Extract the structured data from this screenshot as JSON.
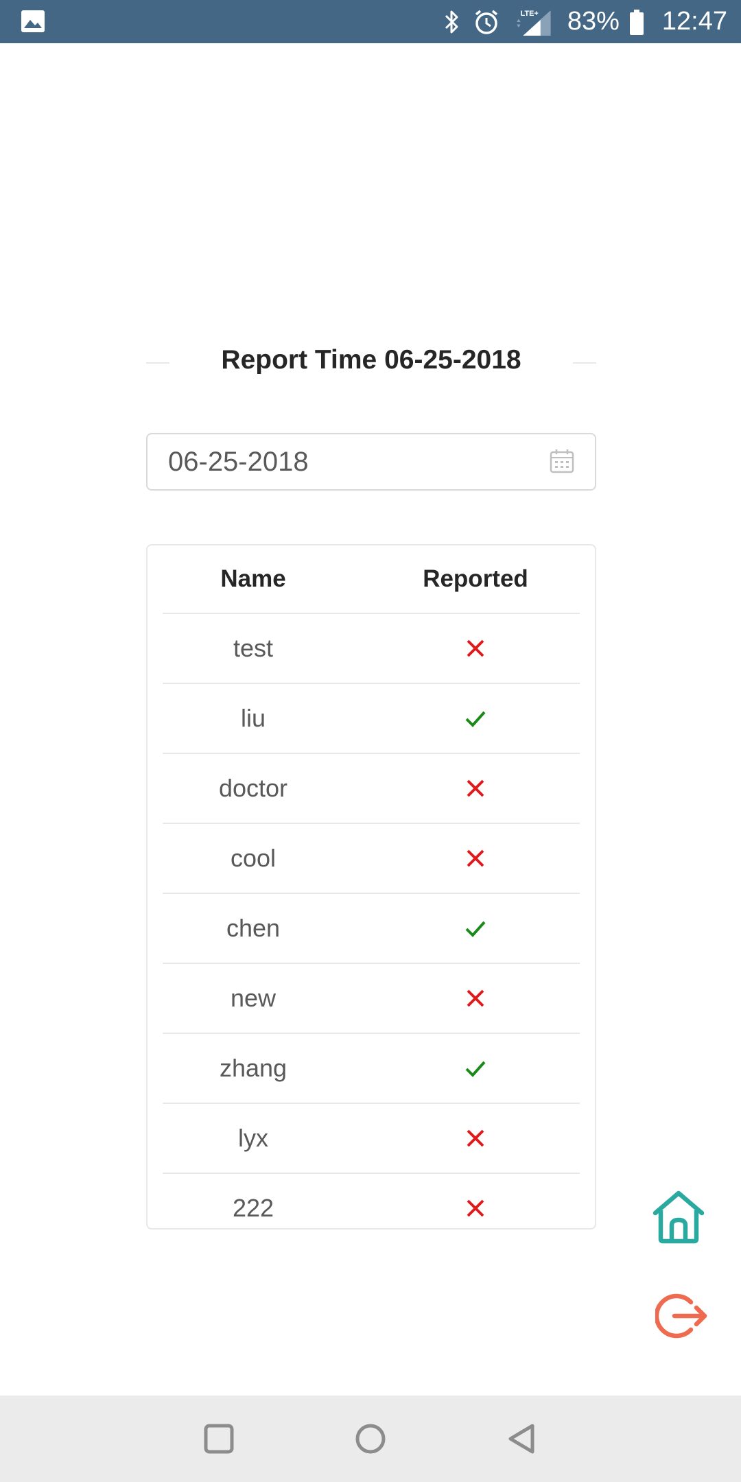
{
  "status_bar": {
    "battery": "83%",
    "time": "12:47",
    "network": "LTE+",
    "icons": [
      "gallery-icon",
      "bluetooth-icon",
      "alarm-icon",
      "signal-icon",
      "battery-icon"
    ]
  },
  "page": {
    "title": "Report Time 06-25-2018",
    "date_value": "06-25-2018"
  },
  "table": {
    "headers": {
      "name": "Name",
      "reported": "Reported"
    },
    "rows": [
      {
        "name": "test",
        "reported": false
      },
      {
        "name": "liu",
        "reported": true
      },
      {
        "name": "doctor",
        "reported": false
      },
      {
        "name": "cool",
        "reported": false
      },
      {
        "name": "chen",
        "reported": true
      },
      {
        "name": "new",
        "reported": false
      },
      {
        "name": "zhang",
        "reported": true
      },
      {
        "name": "lyx",
        "reported": false
      },
      {
        "name": "222",
        "reported": false
      }
    ]
  },
  "colors": {
    "status_bar": "#436785",
    "check": "#1a8a1a",
    "cross": "#e01a1a",
    "home_button": "#2aa9a0",
    "logout_button": "#ef6b4f"
  },
  "floating_buttons": [
    "home-icon",
    "logout-icon"
  ],
  "nav_bar": [
    "recents-button",
    "home-button",
    "back-button"
  ]
}
